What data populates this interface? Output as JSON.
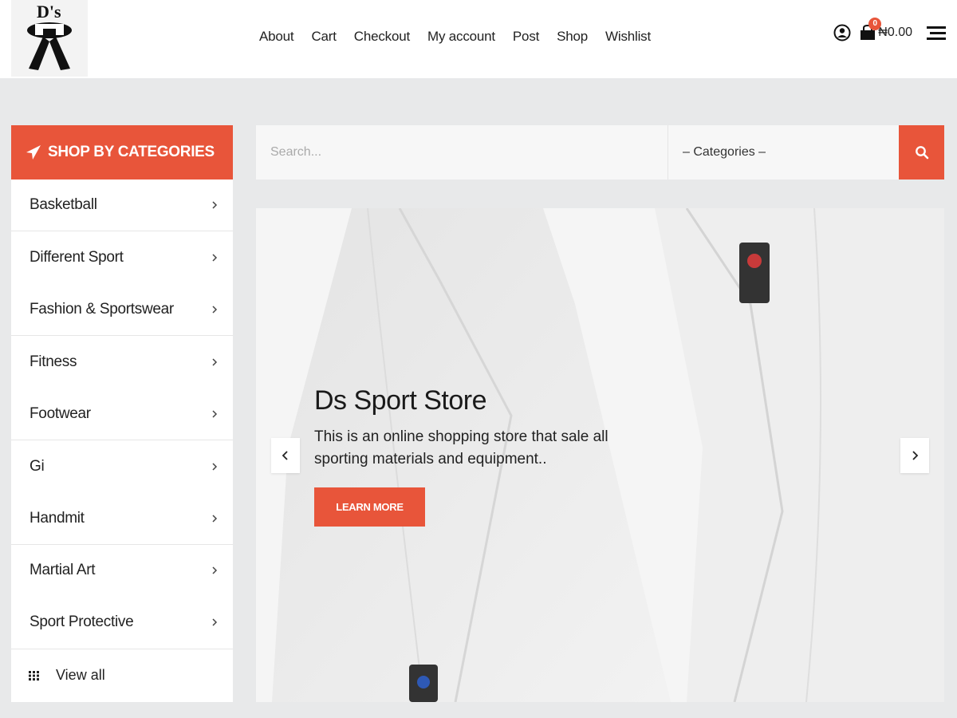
{
  "colors": {
    "accent": "#e8553a",
    "background": "#e8e9ea"
  },
  "header": {
    "logo_text": "D's",
    "nav": [
      "About",
      "Cart",
      "Checkout",
      "My account",
      "Post",
      "Shop",
      "Wishlist"
    ],
    "cart_count": "0",
    "cart_total": "₦0.00",
    "icons": [
      "user-icon",
      "cart-icon",
      "menu-icon"
    ]
  },
  "sidebar": {
    "title": "SHOP BY CATEGORIES",
    "items": [
      {
        "label": "Basketball"
      },
      {
        "label": "Different Sport"
      },
      {
        "label": "Fashion & Sportswear"
      },
      {
        "label": "Fitness"
      },
      {
        "label": "Footwear"
      },
      {
        "label": "Gi"
      },
      {
        "label": "Handmit"
      },
      {
        "label": "Martial Art"
      },
      {
        "label": "Sport Protective"
      }
    ],
    "view_all": "View all"
  },
  "search": {
    "placeholder": "Search...",
    "category_selected": "– Categories –"
  },
  "hero": {
    "title": "Ds Sport Store",
    "text": "This is an online shopping store that sale all sporting materials and equipment..",
    "button": "LEARN MORE"
  }
}
